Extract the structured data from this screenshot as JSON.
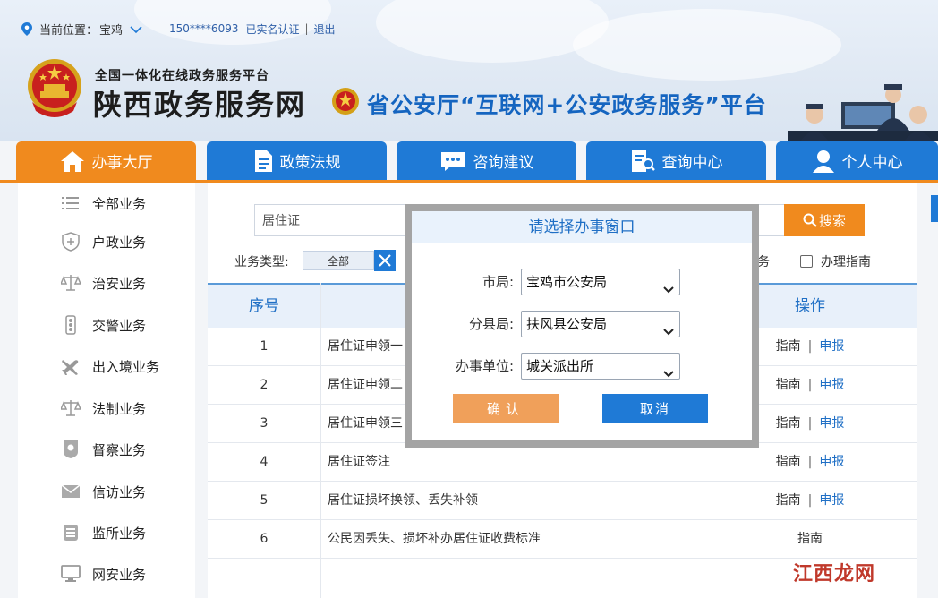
{
  "header": {
    "location_label": "当前位置：",
    "location_city": "宝鸡",
    "phone": "150****6093",
    "verified": "已实名认证",
    "separator": "|",
    "logout": "退出",
    "brand_sub": "全国一体化在线政务服务平台",
    "brand_main": "陕西政务服务网",
    "portal_title": "省公安厅“互联网+公安政务服务”平台"
  },
  "nav": {
    "tabs": [
      {
        "label": "办事大厅",
        "icon": "house-icon",
        "active": true
      },
      {
        "label": "政策法规",
        "icon": "document-icon"
      },
      {
        "label": "咨询建议",
        "icon": "chat-icon"
      },
      {
        "label": "查询中心",
        "icon": "search-doc-icon"
      },
      {
        "label": "个人中心",
        "icon": "user-icon"
      }
    ]
  },
  "sidebar": {
    "items": [
      {
        "label": "全部业务",
        "icon": "list-icon"
      },
      {
        "label": "户政业务",
        "icon": "shield-plus-icon"
      },
      {
        "label": "治安业务",
        "icon": "scale-icon"
      },
      {
        "label": "交警业务",
        "icon": "traffic-light-icon"
      },
      {
        "label": "出入境业务",
        "icon": "airplane-icon"
      },
      {
        "label": "法制业务",
        "icon": "scale-icon"
      },
      {
        "label": "督察业务",
        "icon": "badge-icon"
      },
      {
        "label": "信访业务",
        "icon": "envelope-icon"
      },
      {
        "label": "监所业务",
        "icon": "building-icon"
      },
      {
        "label": "网安业务",
        "icon": "monitor-icon"
      }
    ]
  },
  "search": {
    "value": "居住证",
    "button_label": "搜索"
  },
  "filters": {
    "type_label": "业务类型:",
    "type_value": "全部",
    "partial_text": "业务",
    "guide_checkbox_label": "办理指南"
  },
  "table": {
    "headers": {
      "num": "序号",
      "ops": "操作"
    },
    "rows": [
      {
        "num": "1",
        "name": "居住证申领一",
        "ops": [
          "指南",
          "申报"
        ]
      },
      {
        "num": "2",
        "name": "居住证申领二",
        "ops": [
          "指南",
          "申报"
        ]
      },
      {
        "num": "3",
        "name": "居住证申领三",
        "ops": [
          "指南",
          "申报"
        ]
      },
      {
        "num": "4",
        "name": "居住证签注",
        "ops": [
          "指南",
          "申报"
        ]
      },
      {
        "num": "5",
        "name": "居住证损坏换领、丢失补领",
        "ops": [
          "指南",
          "申报"
        ]
      },
      {
        "num": "6",
        "name": "公民因丢失、损坏补办居住证收费标准",
        "ops": [
          "指南"
        ]
      }
    ],
    "op_separator": "|"
  },
  "modal": {
    "title": "请选择办事窗口",
    "fields": [
      {
        "label": "市局:",
        "value": "宝鸡市公安局"
      },
      {
        "label": "分县局:",
        "value": "扶风县公安局"
      },
      {
        "label": "办事单位:",
        "value": "城关派出所"
      }
    ],
    "confirm_label": "确认",
    "cancel_label": "取消"
  },
  "watermark": {
    "text": "江西龙网"
  },
  "colors": {
    "primary_blue": "#1f7ad6",
    "accent_orange": "#f08a1e",
    "link_blue": "#1f6fc5",
    "watermark_red": "#c0392b"
  }
}
